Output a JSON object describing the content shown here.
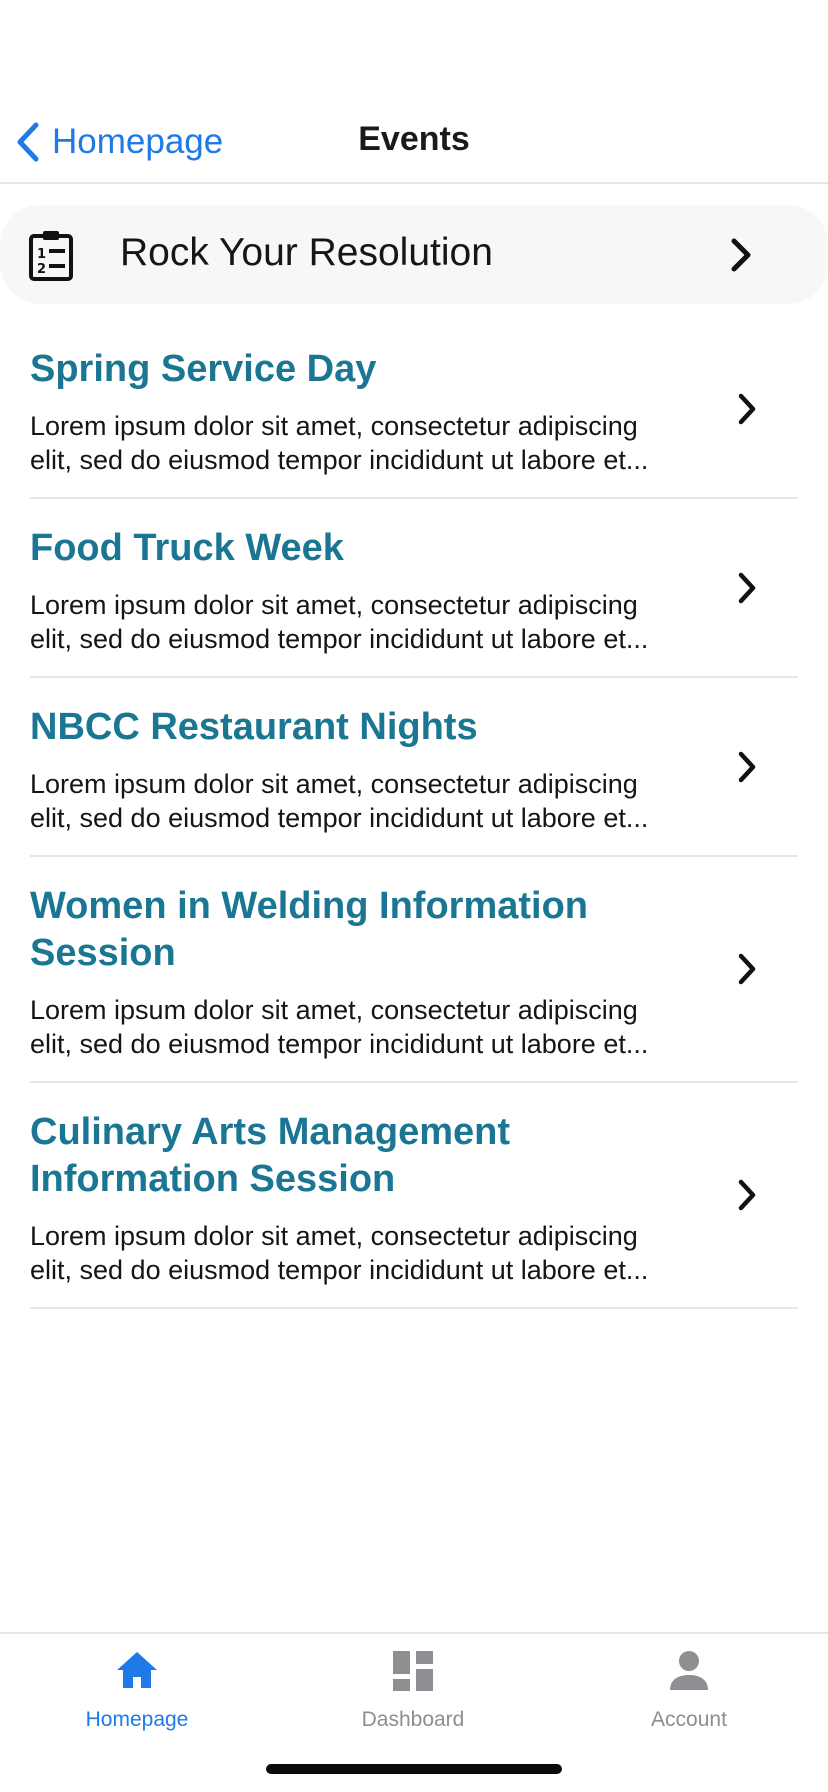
{
  "nav": {
    "back_label": "Homepage",
    "title": "Events",
    "back_icon": "chevron-left-icon"
  },
  "featured": {
    "label": "Rock Your Resolution",
    "icon": "clipboard-list-icon"
  },
  "events": [
    {
      "title_lines": [
        "Spring Service Day"
      ],
      "desc_lines": [
        "Lorem ipsum dolor sit amet, consectetur adipiscing",
        "elit, sed do eiusmod tempor incididunt ut labore et..."
      ]
    },
    {
      "title_lines": [
        "Food Truck Week"
      ],
      "desc_lines": [
        "Lorem ipsum dolor sit amet, consectetur adipiscing",
        "elit, sed do eiusmod tempor incididunt ut labore et..."
      ]
    },
    {
      "title_lines": [
        "NBCC Restaurant Nights"
      ],
      "desc_lines": [
        "Lorem ipsum dolor sit amet, consectetur adipiscing",
        "elit, sed do eiusmod tempor incididunt ut labore et..."
      ]
    },
    {
      "title_lines": [
        "Women in Welding Information",
        "Session"
      ],
      "desc_lines": [
        "Lorem ipsum dolor sit amet, consectetur adipiscing",
        "elit, sed do eiusmod tempor incididunt ut labore et..."
      ]
    },
    {
      "title_lines": [
        "Culinary Arts Management",
        "Information Session"
      ],
      "desc_lines": [
        "Lorem ipsum dolor sit amet, consectetur adipiscing",
        "elit, sed do eiusmod tempor incididunt ut labore et..."
      ]
    }
  ],
  "tabs": [
    {
      "label": "Homepage",
      "icon": "home-icon",
      "active": true
    },
    {
      "label": "Dashboard",
      "icon": "dashboard-icon",
      "active": false
    },
    {
      "label": "Account",
      "icon": "person-icon",
      "active": false
    }
  ],
  "colors": {
    "accent": "#1f7ae8",
    "event_title": "#1a7693",
    "inactive_tab": "#8e8e93"
  }
}
